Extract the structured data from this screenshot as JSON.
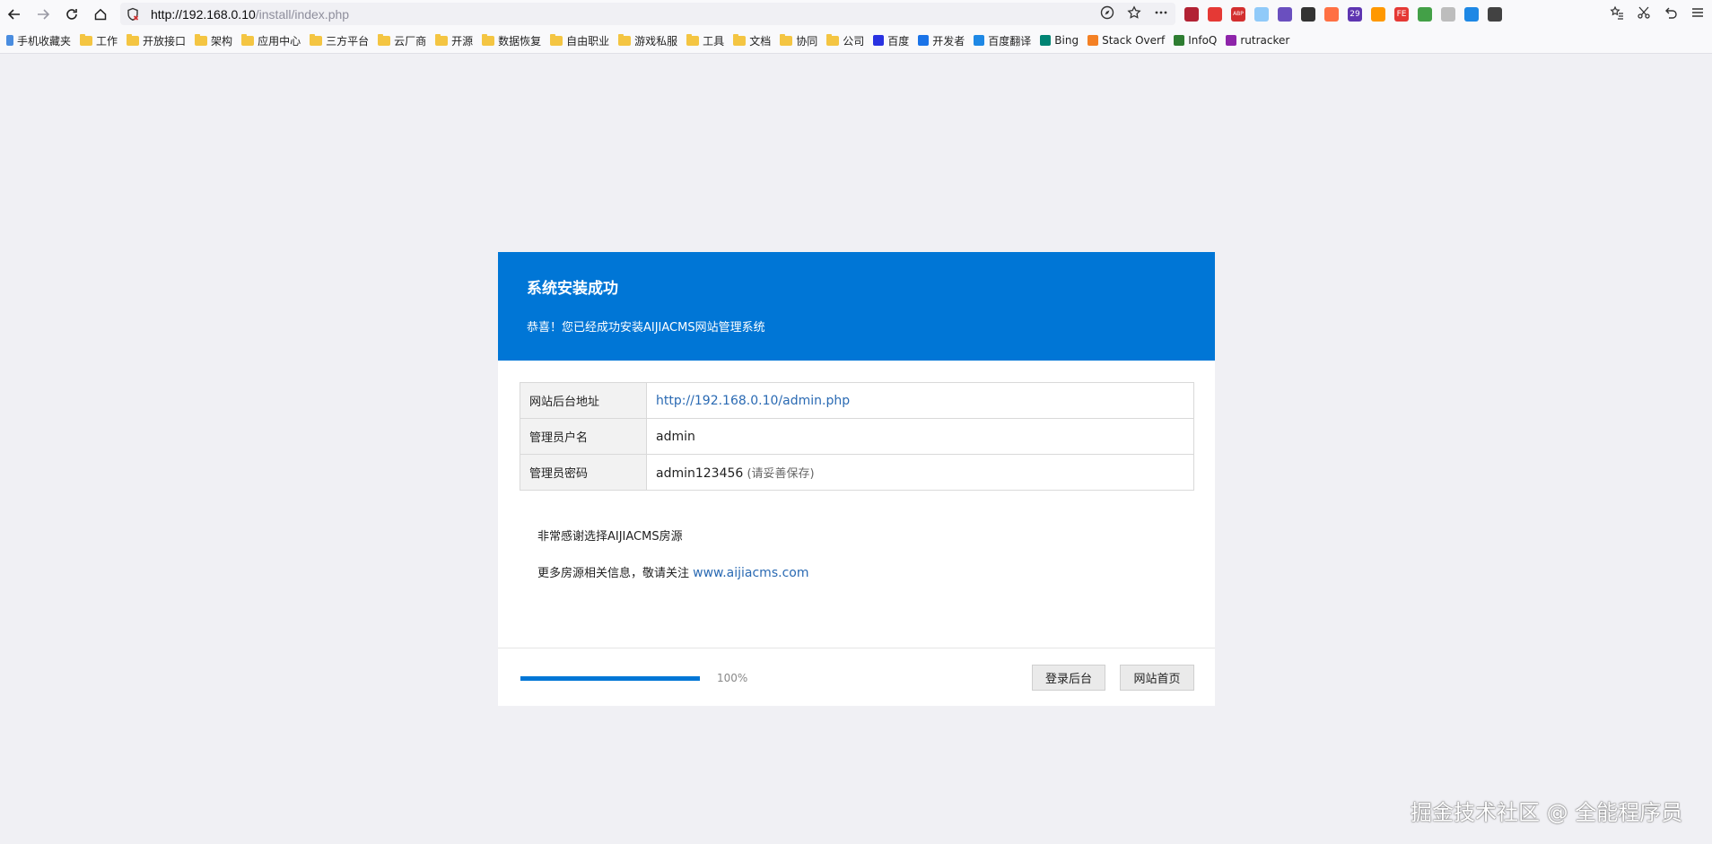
{
  "browser": {
    "url_host": "http://192.168.0.10",
    "url_path": "/install/index.php",
    "bookmarks": [
      {
        "label": "手机收藏夹",
        "type": "mobile"
      },
      {
        "label": "工作",
        "type": "folder"
      },
      {
        "label": "开放接口",
        "type": "folder"
      },
      {
        "label": "架构",
        "type": "folder"
      },
      {
        "label": "应用中心",
        "type": "folder"
      },
      {
        "label": "三方平台",
        "type": "folder"
      },
      {
        "label": "云厂商",
        "type": "folder"
      },
      {
        "label": "开源",
        "type": "folder"
      },
      {
        "label": "数据恢复",
        "type": "folder"
      },
      {
        "label": "自由职业",
        "type": "folder"
      },
      {
        "label": "游戏私服",
        "type": "folder"
      },
      {
        "label": "工具",
        "type": "folder"
      },
      {
        "label": "文档",
        "type": "folder"
      },
      {
        "label": "协同",
        "type": "folder"
      },
      {
        "label": "公司",
        "type": "folder"
      },
      {
        "label": "百度",
        "type": "site",
        "color": "#2932e1"
      },
      {
        "label": "开发者",
        "type": "site",
        "color": "#1a73e8"
      },
      {
        "label": "百度翻译",
        "type": "site",
        "color": "#1e88e5"
      },
      {
        "label": "Bing",
        "type": "site",
        "color": "#008373"
      },
      {
        "label": "Stack Overf",
        "type": "site",
        "color": "#f48024"
      },
      {
        "label": "InfoQ",
        "type": "site",
        "color": "#2e7d32"
      },
      {
        "label": "rutracker",
        "type": "site",
        "color": "#8e24aa"
      }
    ],
    "extensions": [
      {
        "name": "flag-extension",
        "color": "#b22234"
      },
      {
        "name": "red-extension",
        "color": "#e53935"
      },
      {
        "name": "abp-extension",
        "color": "#d32f2f",
        "text": "ABP"
      },
      {
        "name": "circle-extension",
        "color": "#90caf9"
      },
      {
        "name": "purple-extension",
        "color": "#6a4fbf"
      },
      {
        "name": "dark-extension",
        "color": "#333333"
      },
      {
        "name": "orange-extension",
        "color": "#ff7043"
      },
      {
        "name": "hat-extension",
        "color": "#5e35b1",
        "text": "29"
      },
      {
        "name": "moon-extension",
        "color": "#ff9800"
      },
      {
        "name": "fe-extension",
        "color": "#e53935",
        "text": "FE"
      },
      {
        "name": "shield-extension",
        "color": "#43a047"
      },
      {
        "name": "grey-extension",
        "color": "#bdbdbd"
      },
      {
        "name": "blue-extension",
        "color": "#1e88e5"
      },
      {
        "name": "grid-extension",
        "color": "#424242"
      }
    ]
  },
  "install": {
    "title": "系统安装成功",
    "subtitle": "恭喜！您已经成功安装AIJIACMS网站管理系统",
    "rows": [
      {
        "label": "网站后台地址",
        "value": "http://192.168.0.10/admin.php",
        "link": true,
        "note": ""
      },
      {
        "label": "管理员户名",
        "value": "admin",
        "link": false,
        "note": ""
      },
      {
        "label": "管理员密码",
        "value": "admin123456",
        "link": false,
        "note": " (请妥善保存)"
      }
    ],
    "thanks_line": "非常感谢选择AIJIACMS房源",
    "more_info_prefix": "更多房源相关信息，敬请关注 ",
    "more_info_link": "www.aijiacms.com",
    "progress_fraction": 1.0,
    "progress_label": "100%",
    "login_button": "登录后台",
    "home_button": "网站首页",
    "accent_color": "#0076d6"
  },
  "watermark": "掘金技术社区 @ 全能程序员"
}
